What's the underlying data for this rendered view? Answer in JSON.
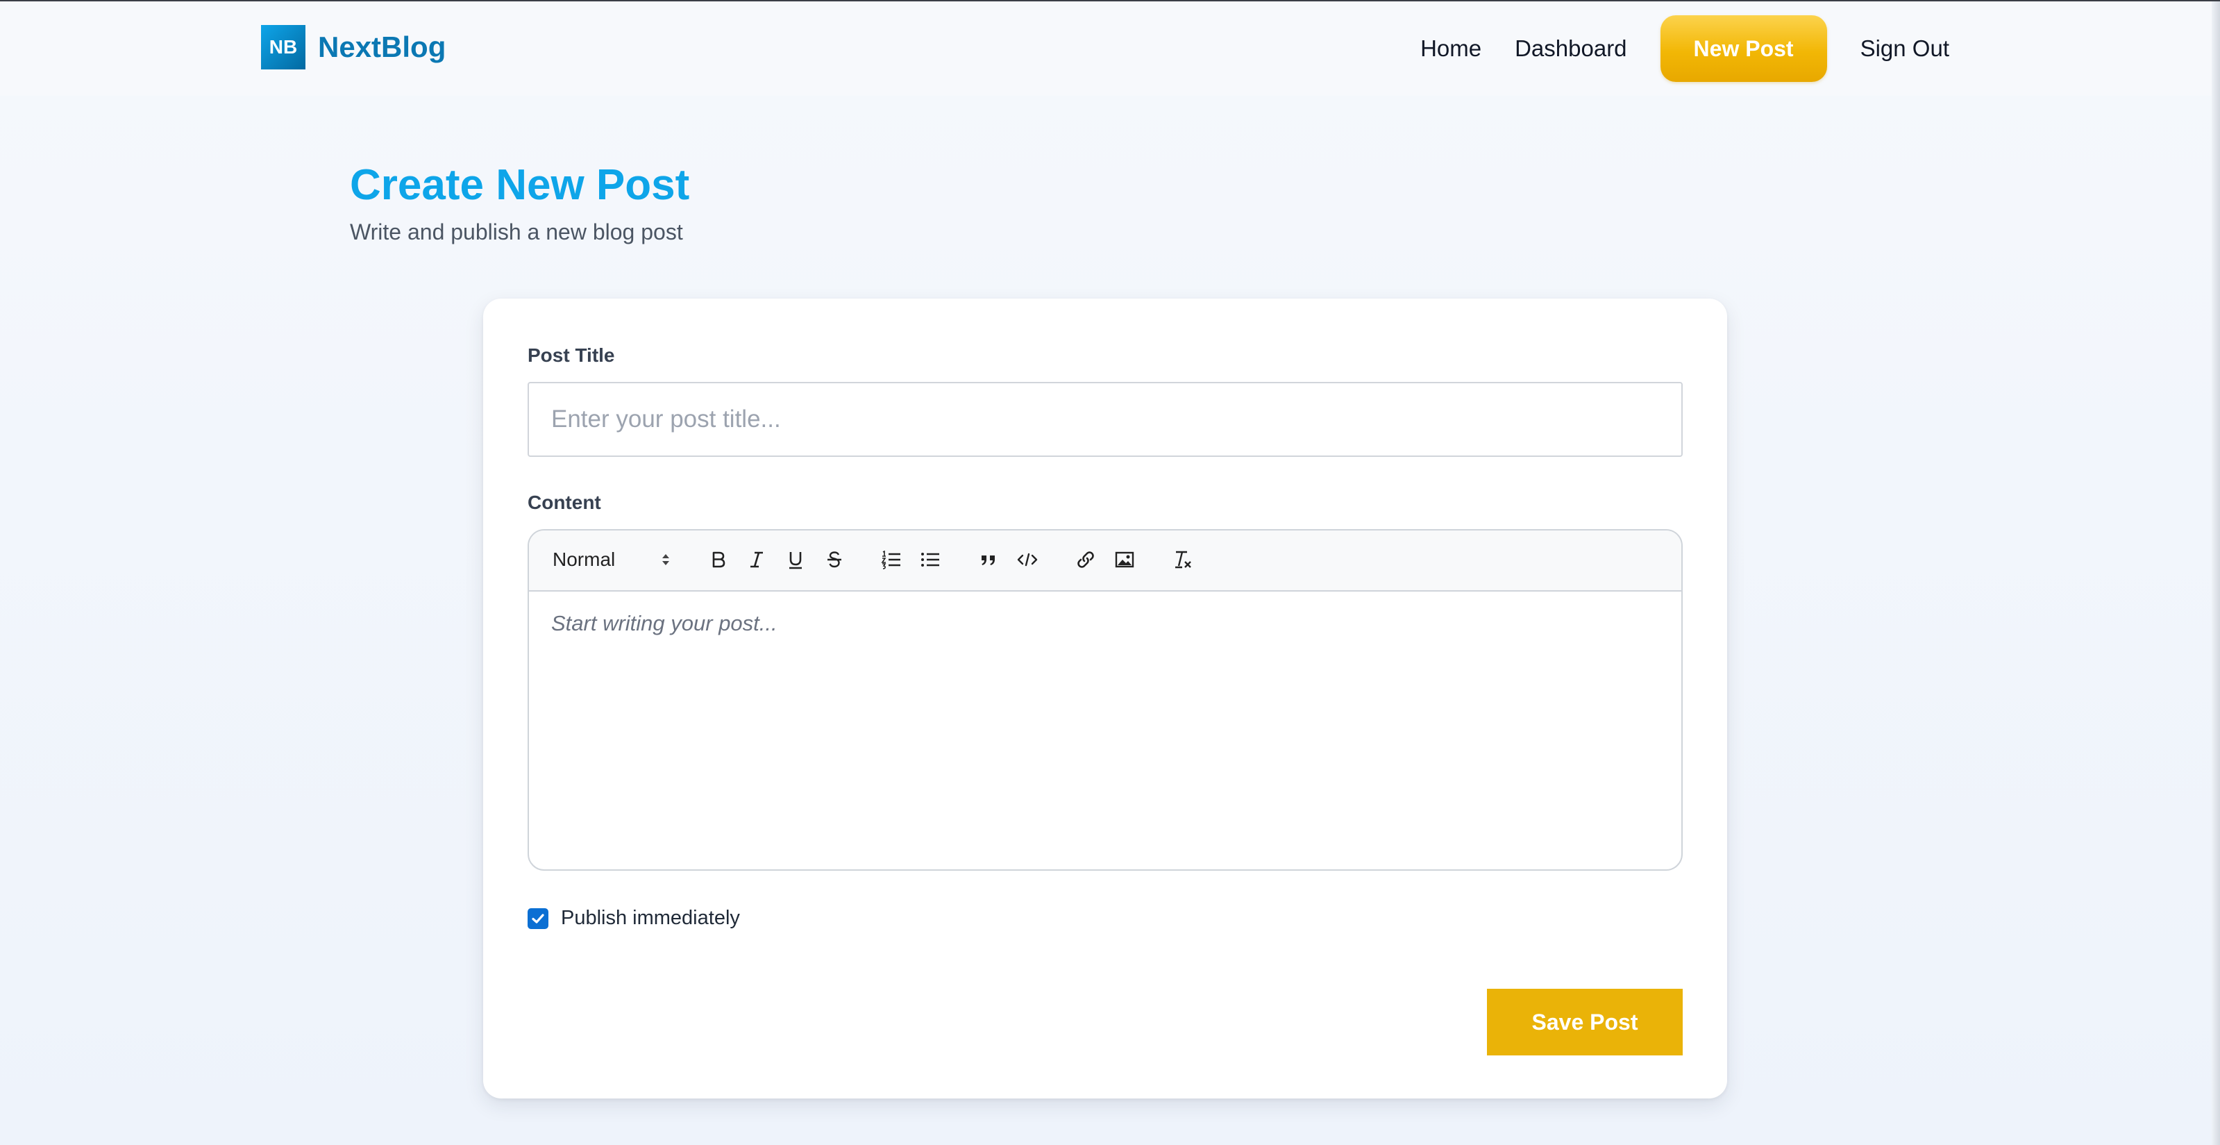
{
  "brand": {
    "badge": "NB",
    "name": "NextBlog"
  },
  "nav": {
    "home": "Home",
    "dashboard": "Dashboard",
    "new_post": "New Post",
    "sign_out": "Sign Out"
  },
  "page": {
    "title": "Create New Post",
    "subtitle": "Write and publish a new blog post"
  },
  "form": {
    "title_label": "Post Title",
    "title_placeholder": "Enter your post title...",
    "title_value": "",
    "content_label": "Content",
    "editor": {
      "format_value": "Normal",
      "placeholder": "Start writing your post...",
      "toolbar_icons": [
        "bold-icon",
        "italic-icon",
        "underline-icon",
        "strikethrough-icon",
        "ordered-list-icon",
        "bullet-list-icon",
        "blockquote-icon",
        "code-block-icon",
        "link-icon",
        "image-icon",
        "clear-formatting-icon"
      ]
    },
    "publish_label": "Publish immediately",
    "publish_checked": true,
    "save_label": "Save Post"
  },
  "colors": {
    "brand": "#0ea5e9",
    "brand_dark": "#0b78b3",
    "accent": "#eab308",
    "checkbox": "#0b6fd3"
  }
}
